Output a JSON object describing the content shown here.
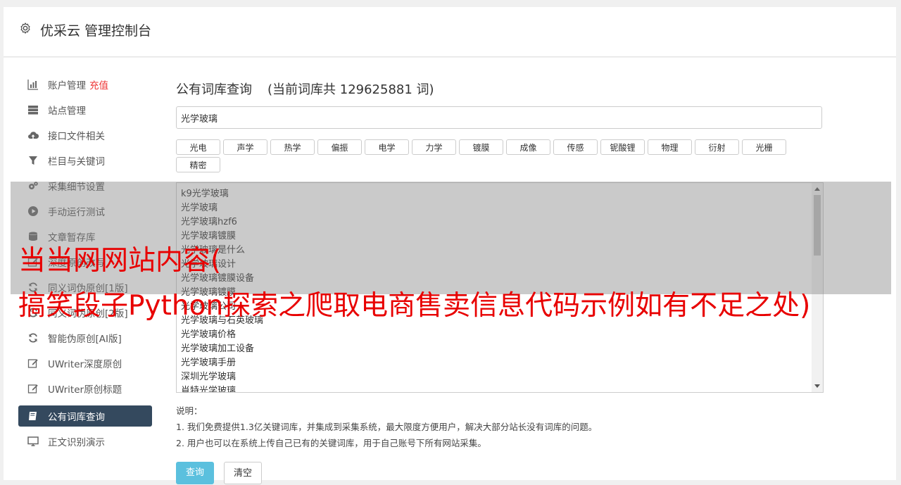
{
  "header": {
    "title": "优采云 管理控制台"
  },
  "sidebar": {
    "items": [
      {
        "label": "账户管理",
        "extra": "充值",
        "icon": "bar-chart-icon"
      },
      {
        "label": "站点管理",
        "icon": "server-icon"
      },
      {
        "label": "接口文件相关",
        "icon": "cloud-upload-icon"
      },
      {
        "label": "栏目与关键词",
        "icon": "filter-icon"
      },
      {
        "label": "采集细节设置",
        "icon": "cogs-icon"
      },
      {
        "label": "手动运行测试",
        "icon": "play-icon"
      },
      {
        "label": "文章暂存库",
        "icon": "database-icon"
      },
      {
        "label": "深度原创改写",
        "icon": "edit-icon"
      },
      {
        "label": "同义词伪原创[1版]",
        "icon": "refresh-icon"
      },
      {
        "label": "同义词伪原创[2版]",
        "icon": "refresh-icon"
      },
      {
        "label": "智能伪原创[AI版]",
        "icon": "refresh-icon"
      },
      {
        "label": "UWriter深度原创",
        "icon": "edit-icon"
      },
      {
        "label": "UWriter原创标题",
        "icon": "edit-icon"
      },
      {
        "label": "公有词库查询",
        "icon": "book-icon",
        "active": true
      },
      {
        "label": "正文识别演示",
        "icon": "monitor-icon"
      }
    ]
  },
  "main": {
    "title": "公有词库查询",
    "count_text": "(当前词库共 129625881 词)",
    "search_value": "光学玻璃",
    "tags": [
      "光电",
      "声学",
      "热学",
      "偏振",
      "电学",
      "力学",
      "镀膜",
      "成像",
      "传感",
      "铌酸锂",
      "物理",
      "衍射",
      "光栅",
      "精密"
    ],
    "results": [
      "k9光学玻璃",
      "光学玻璃",
      "光学玻璃hzf6",
      "光学玻璃镀膜",
      "光学玻璃是什么",
      "光学玻璃设计",
      "光学玻璃镀膜设备",
      "光学玻璃镀膜",
      "光学玻璃公司",
      "光学玻璃与石英玻璃",
      "光学玻璃价格",
      "光学玻璃加工设备",
      "光学玻璃手册",
      "深圳光学玻璃",
      "肖特光学玻璃"
    ],
    "notes": {
      "heading": "说明：",
      "line1": "1. 我们免费提供1.3亿关键词库，并集成到采集系统，最大限度方便用户，解决大部分站长没有词库的问题。",
      "line2": "2. 用户也可以在系统上传自己已有的关键词库，用于自己账号下所有网站采集。"
    },
    "buttons": {
      "query": "查询",
      "clear": "清空"
    }
  },
  "overlay": {
    "line1": "当当网网站内容(",
    "line2": "搞笑段子Python探索之爬取电商售卖信息代码示例如有不足之处)"
  },
  "colors": {
    "sidebar_active": "#34495e",
    "accent": "#5bc0de",
    "overlay_text": "#e80000"
  }
}
